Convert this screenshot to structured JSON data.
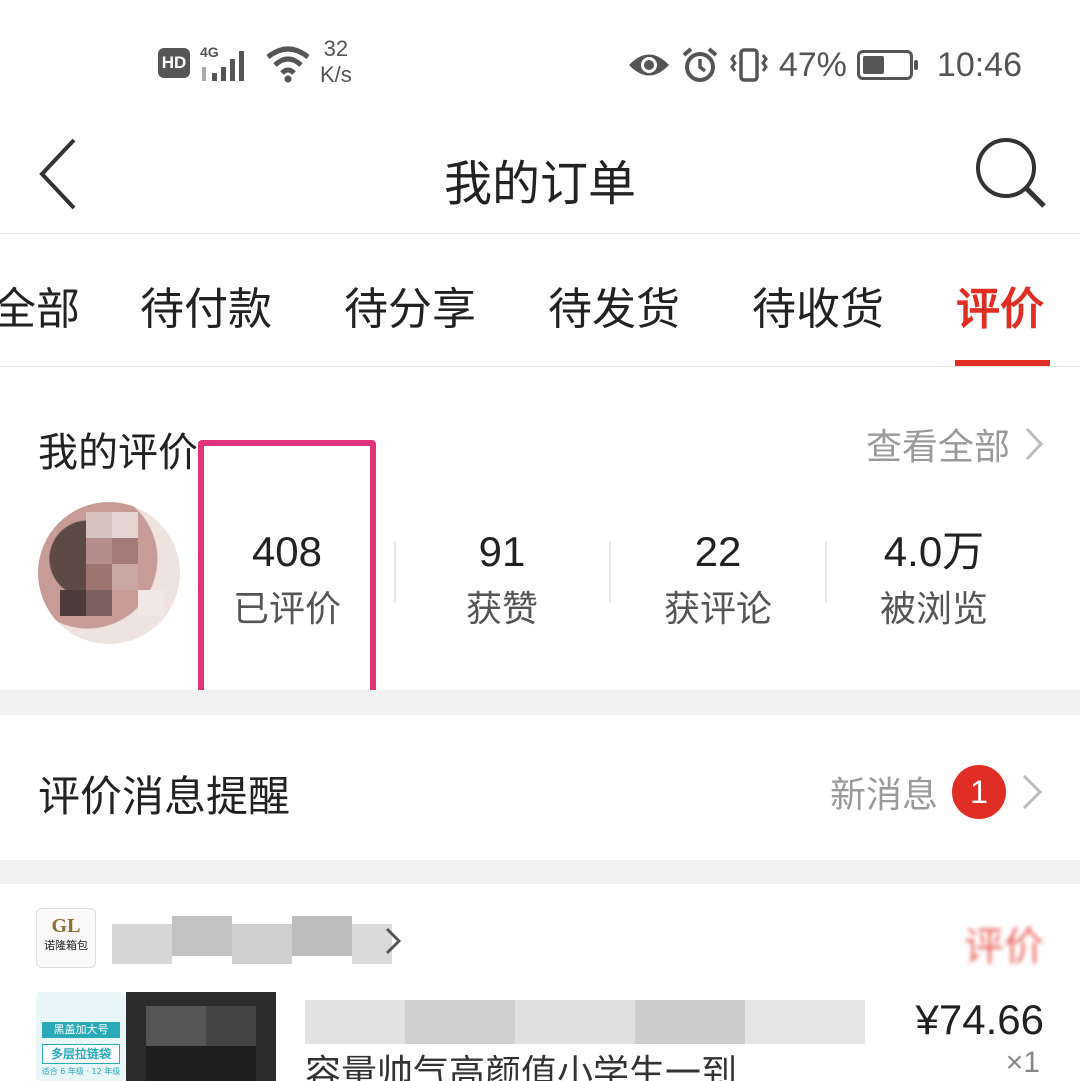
{
  "status_bar": {
    "hd": "HD",
    "network": "4G",
    "speed_value": "32",
    "speed_unit": "K/s",
    "battery_percent": "47%",
    "battery_level": 0.47,
    "time": "10:46"
  },
  "header": {
    "title": "我的订单"
  },
  "tabs": [
    {
      "label": "全部"
    },
    {
      "label": "待付款"
    },
    {
      "label": "待分享"
    },
    {
      "label": "待发货"
    },
    {
      "label": "待收货"
    },
    {
      "label": "评价",
      "active": true
    }
  ],
  "my_reviews": {
    "title": "我的评价",
    "view_all": "查看全部",
    "stats": [
      {
        "value": "408",
        "label": "已评价"
      },
      {
        "value": "91",
        "label": "获赞"
      },
      {
        "value": "22",
        "label": "获评论"
      },
      {
        "value": "4.0万",
        "label": "被浏览"
      }
    ]
  },
  "messages": {
    "title": "评价消息提醒",
    "new_label": "新消息",
    "badge": "1"
  },
  "order": {
    "shop_logo": "GL",
    "shop_logo_sub": "诺隆箱包",
    "review_status": "评价",
    "thumb_tag": "黑盖加大号",
    "thumb_tag2": "多层拉链袋",
    "thumb_tag3": "适合 6 年级 · 12 年级",
    "product_title": "容量帅气高颜值小学生一到",
    "price": "¥74.66",
    "quantity": "×1"
  },
  "colors": {
    "accent": "#e02e24",
    "highlight": "#e0347a",
    "muted": "#9a9a9a"
  },
  "icons": [
    "hd-icon",
    "signal-icon",
    "wifi-icon",
    "eye-icon",
    "alarm-icon",
    "vibrate-icon",
    "battery-icon",
    "back-arrow-icon",
    "search-icon",
    "chevron-right-icon"
  ]
}
